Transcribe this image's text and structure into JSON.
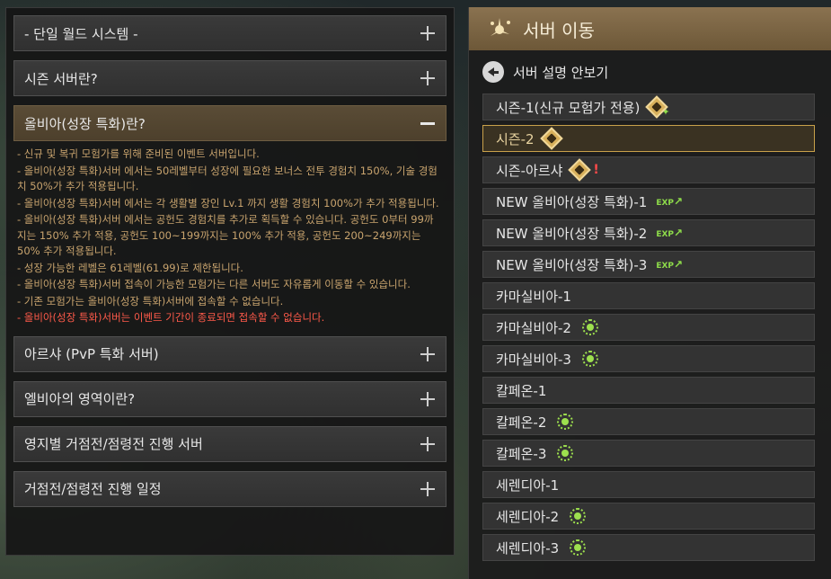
{
  "left_panel": {
    "sections": [
      {
        "title": "- 단일 월드 시스템 -",
        "open": false
      },
      {
        "title": "시즌 서버란?",
        "open": false
      },
      {
        "title": "올비아(성장 특화)란?",
        "open": true
      },
      {
        "title": "아르샤 (PvP 특화 서버)",
        "open": false
      },
      {
        "title": "엘비아의 영역이란?",
        "open": false
      },
      {
        "title": "영지별 거점전/점령전 진행 서버",
        "open": false
      },
      {
        "title": "거점전/점령전 진행 일정",
        "open": false
      }
    ],
    "description": [
      "- 신규 및 복귀 모험가를 위해 준비된 이벤트 서버입니다.",
      "- 올비아(성장 특화)서버 에서는 50레벨부터 성장에 필요한 보너스 전투 경험치 150%, 기술 경험치 50%가 추가 적용됩니다.",
      "- 올비아(성장 특화)서버 에서는 각 생활별 장인 Lv.1 까지 생활 경험치 100%가 추가 적용됩니다.",
      "- 올비아(성장 특화)서버 에서는 공헌도 경험치를 추가로 획득할 수 있습니다. 공헌도 0부터 99까지는 150% 추가 적용, 공헌도 100~199까지는 100% 추가 적용, 공헌도 200~249까지는 50% 추가 적용됩니다.",
      "- 성장 가능한 레벨은 61레벨(61.99)로 제한됩니다.",
      "- 올비아(성장 특화)서버 접속이 가능한 모험가는 다른 서버도 자유롭게 이동할 수 있습니다.",
      "- 기존 모험가는 올비아(성장 특화)서버에 접속할 수 없습니다."
    ],
    "warning": "- 올비아(성장 특화)서버는 이벤트 기간이 종료되면 접속할 수 없습니다."
  },
  "right_panel": {
    "title": "서버 이동",
    "back_label": "서버 설명 안보기",
    "servers": [
      {
        "name": "시즌-1(신규 모험가 전용)",
        "badge": "season-sprout"
      },
      {
        "name": "시즌-2",
        "badge": "season",
        "selected": true
      },
      {
        "name": "시즌-아르샤",
        "badge": "season-pvp"
      },
      {
        "name": "NEW 올비아(성장 특화)-1",
        "badge": "exp"
      },
      {
        "name": "NEW 올비아(성장 특화)-2",
        "badge": "exp"
      },
      {
        "name": "NEW 올비아(성장 특화)-3",
        "badge": "exp"
      },
      {
        "name": "카마실비아-1",
        "badge": ""
      },
      {
        "name": "카마실비아-2",
        "badge": "sun"
      },
      {
        "name": "카마실비아-3",
        "badge": "sun"
      },
      {
        "name": "칼페온-1",
        "badge": ""
      },
      {
        "name": "칼페온-2",
        "badge": "sun"
      },
      {
        "name": "칼페온-3",
        "badge": "sun"
      },
      {
        "name": "세렌디아-1",
        "badge": ""
      },
      {
        "name": "세렌디아-2",
        "badge": "sun"
      },
      {
        "name": "세렌디아-3",
        "badge": "sun"
      }
    ],
    "exp_text": "EXP",
    "pvp_text": "!"
  }
}
